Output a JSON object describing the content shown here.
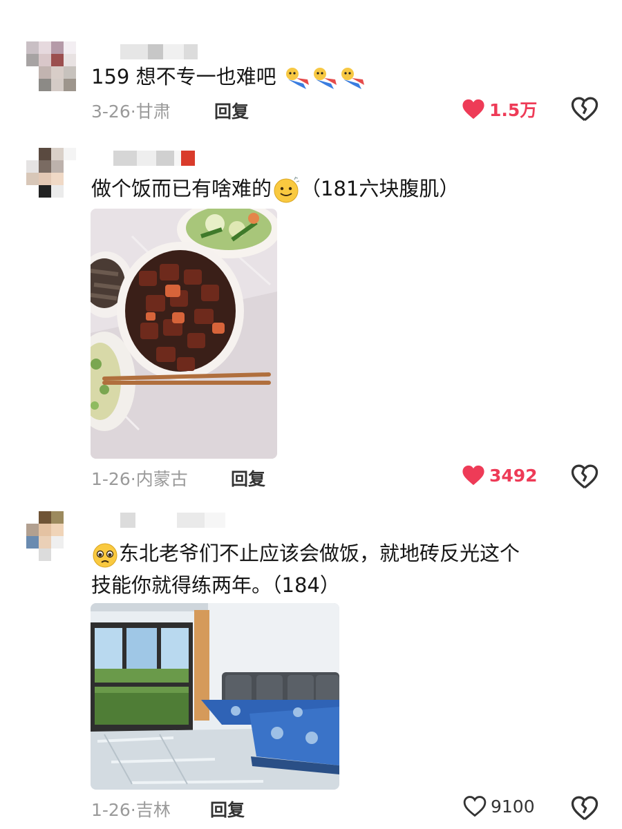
{
  "comments": [
    {
      "text": "159 想不专一也难吧",
      "date": "3-26",
      "location": "甘肃",
      "reply_label": "回复",
      "likes": "1.5万",
      "liked": true
    },
    {
      "text": "做个饭而已有啥难的",
      "text_suffix": "（181六块腹肌）",
      "date": "1-26",
      "location": "内蒙古",
      "reply_label": "回复",
      "likes": "3492",
      "liked": true,
      "photo_icon": "braised-pork-dinner-photo"
    },
    {
      "text_line1": "东北老爷们不止应该会做饭，就地砖反光这个",
      "text_line2": "技能你就得练两年。（184）",
      "date": "1-26",
      "location": "吉林",
      "reply_label": "回复",
      "likes": "9100",
      "liked": false,
      "photo_icon": "living-room-photo"
    }
  ],
  "colors": {
    "like_active": "#ee3b57",
    "meta": "#9a9a9a"
  },
  "icons": [
    "heart-icon",
    "broken-heart-icon",
    "fox-emoji",
    "smile-emoji",
    "pleading-emoji"
  ]
}
